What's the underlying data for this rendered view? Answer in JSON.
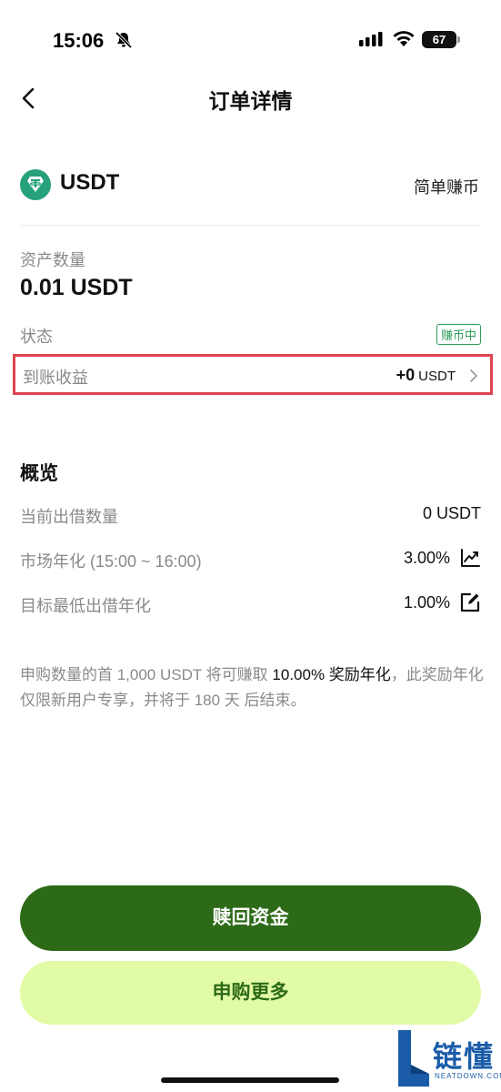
{
  "status_bar": {
    "time": "15:06",
    "battery": "67"
  },
  "nav": {
    "title": "订单详情"
  },
  "asset": {
    "symbol": "USDT",
    "product": "简单赚币",
    "icon": "tether-icon",
    "icon_color": "#26a17b"
  },
  "details": {
    "quantity_label": "资产数量",
    "quantity_value": "0.01 USDT",
    "status_label": "状态",
    "status_badge": "赚币中",
    "earnings_label": "到账收益",
    "earnings_value": "+0",
    "earnings_unit": "USDT"
  },
  "overview": {
    "title": "概览",
    "rows": [
      {
        "label": "当前出借数量",
        "value": "0 USDT"
      },
      {
        "label": "市场年化 (15:00 ~ 16:00)",
        "value": "3.00%",
        "icon": "trend-chart-icon"
      },
      {
        "label": "目标最低出借年化",
        "value": "1.00%",
        "icon": "edit-icon"
      }
    ]
  },
  "note": {
    "part1": "申购数量的首 1,000 USDT 将可赚取 ",
    "highlight": "10.00% 奖励年化",
    "part2": "，此奖励年化仅限新用户专享，并将于 180 天 后结束。"
  },
  "actions": {
    "redeem": "赎回资金",
    "subscribe_more": "申购更多"
  },
  "watermark": {
    "text": "链懂",
    "sub": "NEATDOWN.COM"
  },
  "colors": {
    "primary": "#2d6a18",
    "secondary_bg": "#e2fba6",
    "highlight_border": "#e0454f",
    "badge": "#2e9d56"
  }
}
